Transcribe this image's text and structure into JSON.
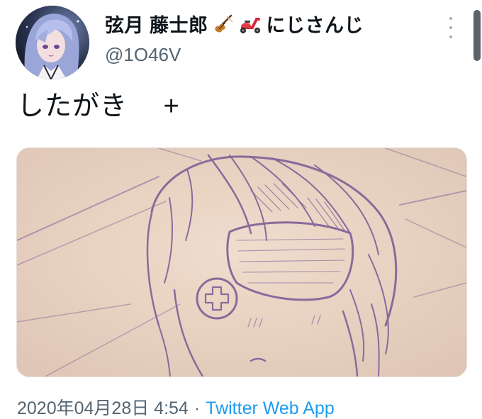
{
  "user": {
    "display_name": "弦月 藤士郎",
    "affiliation": "にじさんじ",
    "handle": "@1O46V",
    "emoji_icons": [
      "violin-icon",
      "scooter-icon"
    ]
  },
  "tweet": {
    "text": "したがき　 +",
    "timestamp": "2020年04月28日 4:54",
    "separator": "·",
    "source": "Twitter Web App"
  },
  "colors": {
    "text": "#0f1419",
    "secondary": "#536471",
    "link": "#1d9bf0",
    "paper": "#e9d3c3",
    "pencil": "#8a6a9a"
  }
}
